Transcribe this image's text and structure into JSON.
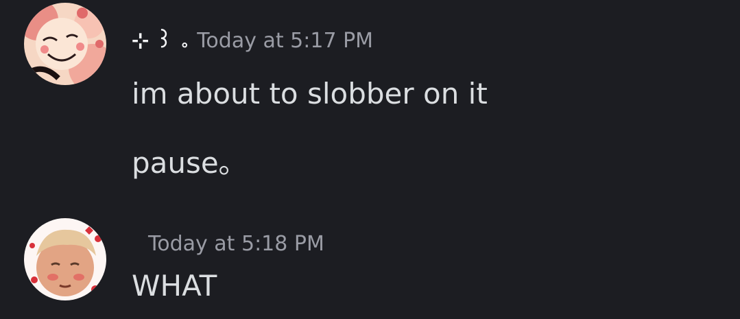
{
  "messages": [
    {
      "username": "⊹ ꒱ ｡",
      "timestamp": "Today at 5:17 PM",
      "lines": [
        "im about to slobber on it",
        "pause｡"
      ]
    },
    {
      "username": "",
      "timestamp": "Today at 5:18 PM",
      "lines": [
        "WHAT"
      ]
    }
  ],
  "colors": {
    "background": "#1c1d22",
    "message_text": "#dbdee1",
    "timestamp": "#9a9ca5"
  }
}
